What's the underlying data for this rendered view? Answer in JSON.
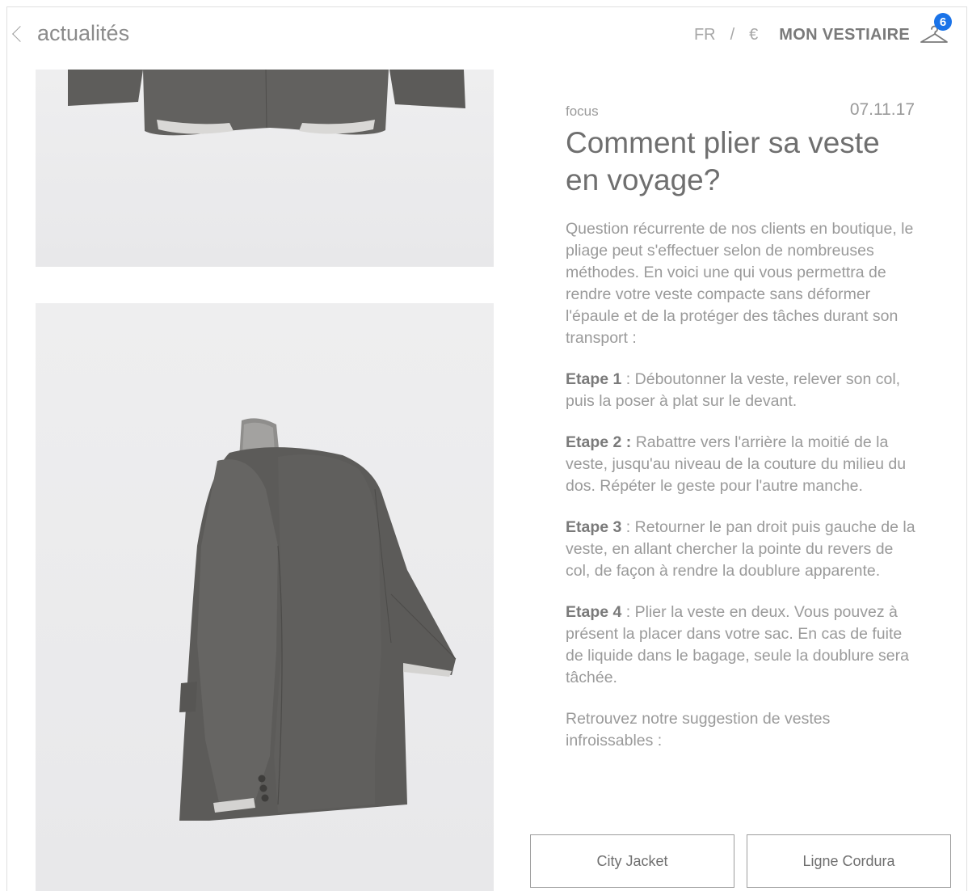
{
  "header": {
    "back_label": "actualités",
    "lang": "FR",
    "separator": "/",
    "currency": "€",
    "wardrobe_label": "MON VESTIAIRE",
    "wardrobe_count": "6"
  },
  "article": {
    "category": "focus",
    "date": "07.11.17",
    "title": "Comment plier sa veste en voyage?",
    "intro": "Question récurrente de nos clients en boutique, le pliage peut s'effectuer selon de nombreuses méthodes. En voici une qui vous permettra de rendre votre veste compacte sans déformer l'épaule et de la protéger des tâches durant son transport :",
    "steps": [
      {
        "label": "Etape 1",
        "sep": " : ",
        "text": "Déboutonner la veste, relever son col, puis la poser à plat sur le devant."
      },
      {
        "label": "Etape 2 :",
        "sep": " ",
        "text": "Rabattre vers l'arrière la moitié de la veste, jusqu'au niveau de la couture du milieu du dos. Répéter le geste pour l'autre manche."
      },
      {
        "label": "Etape 3",
        "sep": " : ",
        "text": "Retourner le pan droit puis gauche de la veste, en allant chercher la pointe du revers de col, de façon à rendre la doublure apparente."
      },
      {
        "label": "Etape 4",
        "sep": " : ",
        "text": "Plier la veste en deux. Vous pouvez à présent la placer dans votre sac. En cas de fuite de liquide dans le bagage, seule la doublure sera tâchée."
      }
    ],
    "outro": "Retrouvez notre suggestion de vestes infroissables :"
  },
  "buttons": {
    "city_jacket": "City Jacket",
    "ligne_cordura": "Ligne Cordura"
  },
  "colors": {
    "badge": "#1a73e8",
    "jacket": "#5e5d5b"
  }
}
